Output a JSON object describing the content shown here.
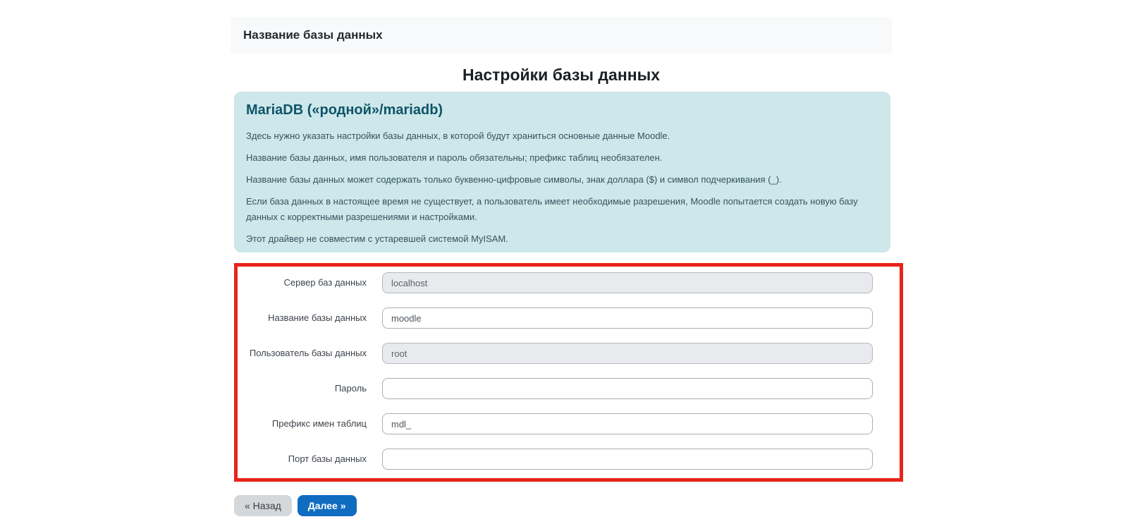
{
  "header": {
    "step_title": "Название базы данных"
  },
  "page": {
    "heading": "Настройки базы данных"
  },
  "info_box": {
    "title": "MariaDB («родной»/mariadb)",
    "paragraphs": [
      "Здесь нужно указать настройки базы данных, в которой будут храниться основные данные Moodle.",
      "Название базы данных, имя пользователя и пароль обязательны; префикс таблиц необязателен.",
      "Название базы данных может содержать только буквенно-цифровые символы, знак доллара ($) и символ подчеркивания (_).",
      "Если база данных в настоящее время не существует, а пользователь имеет необходимые разрешения, Moodle попытается создать новую базу данных с корректными разрешениями и настройками.",
      "Этот драйвер не совместим с устаревшей системой MyISAM."
    ]
  },
  "form": {
    "fields": [
      {
        "label": "Сервер баз данных",
        "value": "localhost",
        "disabled": true
      },
      {
        "label": "Название базы данных",
        "value": "moodle",
        "disabled": false
      },
      {
        "label": "Пользователь базы данных",
        "value": "root",
        "disabled": true
      },
      {
        "label": "Пароль",
        "value": "",
        "disabled": false
      },
      {
        "label": "Префикс имен таблиц",
        "value": "mdl_",
        "disabled": false
      },
      {
        "label": "Порт базы данных",
        "value": "",
        "disabled": false
      }
    ]
  },
  "buttons": {
    "back": "« Назад",
    "next": "Далее »"
  },
  "colors": {
    "highlight_border": "#e82319",
    "primary_button": "#0f6cbf",
    "info_background": "#cde7ea",
    "info_title_text": "#0e5468",
    "step_bar_background": "#f8f9fa"
  }
}
